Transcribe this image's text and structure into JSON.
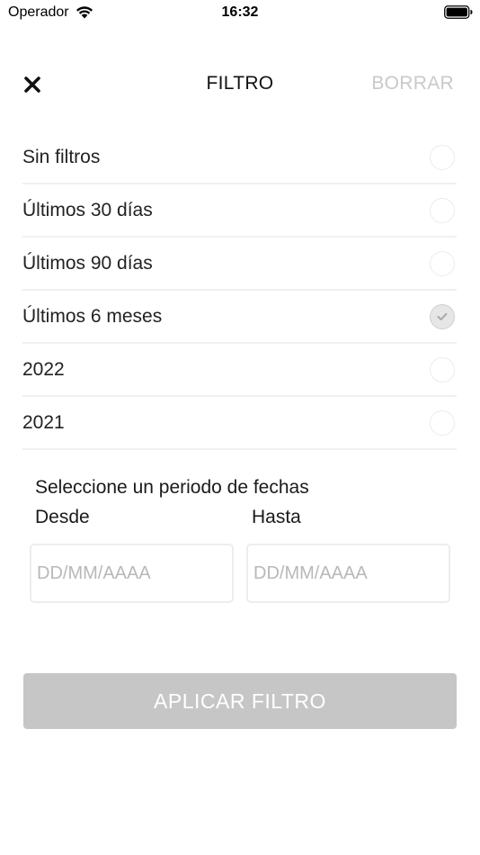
{
  "status_bar": {
    "carrier": "Operador",
    "time": "16:32"
  },
  "header": {
    "title": "FILTRO",
    "clear_label": "BORRAR"
  },
  "filters": [
    {
      "label": "Sin filtros",
      "checked": false
    },
    {
      "label": "Últimos 30 días",
      "checked": false
    },
    {
      "label": "Últimos 90 días",
      "checked": false
    },
    {
      "label": "Últimos 6 meses",
      "checked": true
    },
    {
      "label": "2022",
      "checked": false
    },
    {
      "label": "2021",
      "checked": false
    }
  ],
  "date_range": {
    "title": "Seleccione un periodo de fechas",
    "from_label": "Desde",
    "to_label": "Hasta",
    "from_placeholder": "DD/MM/AAAA",
    "to_placeholder": "DD/MM/AAAA",
    "from_value": "",
    "to_value": ""
  },
  "apply_label": "APLICAR FILTRO",
  "colors": {
    "apply_bg": "#c6c6c6",
    "clear_text": "#c9c9c9",
    "divider": "#f0f0f0"
  },
  "icons": {
    "close": "close-icon",
    "wifi": "wifi-icon",
    "battery": "battery-icon",
    "check": "checkmark-icon"
  }
}
